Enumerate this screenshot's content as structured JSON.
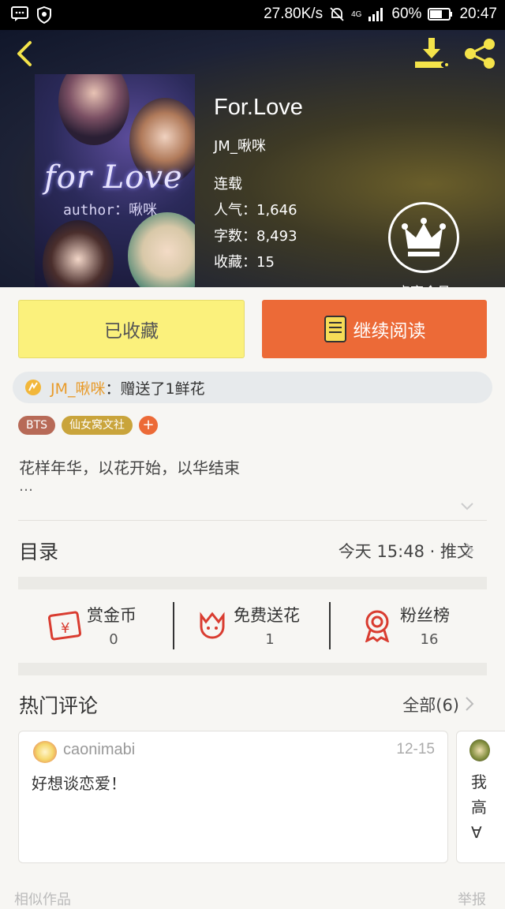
{
  "status": {
    "speed": "27.80K/s",
    "network": "4G",
    "battery": "60%",
    "time": "20:47"
  },
  "book": {
    "title": "For.Love",
    "author": "JM_啾咪",
    "state": "连载",
    "popularity_label": "人气：",
    "popularity": "1,646",
    "words_label": "字数：",
    "words": "8,493",
    "favorites_label": "收藏：",
    "favorites": "15",
    "cover_title": "for Love",
    "cover_author": "author：啾咪"
  },
  "vip": {
    "label": "点亮会员"
  },
  "buttons": {
    "collected": "已收藏",
    "continue": "继续阅读"
  },
  "gift": {
    "user": "JM_啾咪",
    "text": "：赠送了1鲜花"
  },
  "tags": [
    {
      "label": "BTS",
      "color": "#b76a57"
    },
    {
      "label": "仙女窝文社",
      "color": "#c9a43b"
    }
  ],
  "tag_add": "+",
  "description": {
    "line1": "花样年华，以花开始，以华结束",
    "line2": "…"
  },
  "catalog": {
    "title": "目录",
    "update": "今天 15:48 · 推文"
  },
  "stats": [
    {
      "label": "赏金币",
      "value": "0",
      "icon": "red-envelope-yen-icon"
    },
    {
      "label": "免费送花",
      "value": "1",
      "icon": "flower-icon"
    },
    {
      "label": "粉丝榜",
      "value": "16",
      "icon": "ribbon-badge-icon"
    }
  ],
  "comments": {
    "title": "热门评论",
    "all": "全部(6)",
    "items": [
      {
        "user": "caonimabi",
        "date": "12-15",
        "text": "好想谈恋爱！"
      },
      {
        "user": "",
        "date": "",
        "text": "我高∀"
      }
    ]
  },
  "similar": {
    "left": "相似作品",
    "right": "举报"
  },
  "colors": {
    "accent_orange": "#ec6a37",
    "accent_yellow": "#fbf17c",
    "gift_name": "#e89b2a"
  }
}
